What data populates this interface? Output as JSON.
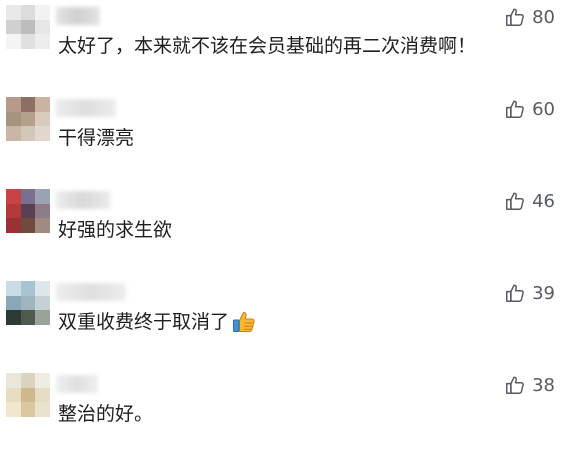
{
  "comments": [
    {
      "text": "太好了，本来就不该在会员基础的再二次消费啊！",
      "likes": "80",
      "avatar_colors": [
        "#e9e9e9",
        "#dcdcdc",
        "#f2f2f2",
        "#d0d0d0",
        "#bdbdbd",
        "#e6e6e6",
        "#f4f4f4",
        "#e0e0e0",
        "#ededed"
      ],
      "name_colors": [
        "#e4e4e4",
        "#cfcfcf"
      ]
    },
    {
      "text": "干得漂亮",
      "likes": "60",
      "avatar_colors": [
        "#b89a8a",
        "#8e6f66",
        "#cbb3a2",
        "#a8937f",
        "#b7a08b",
        "#d9cbbb",
        "#c9b7a6",
        "#d5c7b8",
        "#e2d7cc"
      ],
      "name_colors": [
        "#ececec",
        "#dedede"
      ]
    },
    {
      "text": "好强的求生欲",
      "likes": "46",
      "avatar_colors": [
        "#c84444",
        "#7a6f8e",
        "#9aa2b6",
        "#b33a3a",
        "#5b3f52",
        "#8d7b88",
        "#9b3134",
        "#6f4a3f",
        "#a08a82"
      ],
      "name_colors": [
        "#ebebeb",
        "#d9d9d9"
      ]
    },
    {
      "text": "双重收费终于取消了",
      "likes": "39",
      "avatar_colors": [
        "#c9dce6",
        "#a8c4d2",
        "#dfe6ea",
        "#89a7b6",
        "#9fb4bf",
        "#c6d1d6",
        "#2e3a35",
        "#4c5a4f",
        "#9aa39b"
      ],
      "name_colors": [
        "#ededed",
        "#dfdfdf"
      ]
    },
    {
      "text": "整治的好。",
      "likes": "38",
      "avatar_colors": [
        "#e9e6da",
        "#d9d3bf",
        "#efece3",
        "#e7dcc0",
        "#cdb98d",
        "#e6dcc3",
        "#f1e7cf",
        "#d9c79e",
        "#ebe2cd"
      ],
      "name_colors": [
        "#eeeeee",
        "#e0e0e0"
      ]
    }
  ],
  "icons": {
    "like": "thumbs-up-outline-icon",
    "emoji": "thumbs-up-emoji-icon"
  },
  "colors": {
    "text": "#1f1f1f",
    "like": "#555b66"
  }
}
